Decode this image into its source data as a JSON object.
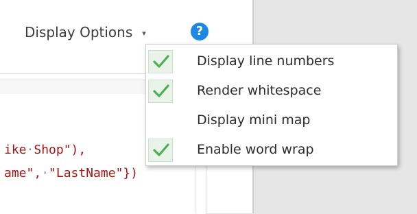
{
  "toolbar": {
    "display_options_label": "Display Options",
    "dropdown_arrow": "▾",
    "help_glyph": "?"
  },
  "editor": {
    "lines": [
      {
        "text_a": "ike",
        "dot": "·",
        "text_b": "Shop\"),",
        "kind": "string-line"
      },
      {
        "text_a": "ame\",",
        "dot": "·",
        "text_b": "\"LastName\"})",
        "kind": "string-line"
      }
    ]
  },
  "menu": {
    "items": [
      {
        "label": "Display line numbers",
        "checked": true
      },
      {
        "label": "Render whitespace",
        "checked": true
      },
      {
        "label": "Display mini map",
        "checked": false
      },
      {
        "label": "Enable word wrap",
        "checked": true
      }
    ]
  },
  "colors": {
    "check_green": "#4caf50",
    "help_blue": "#1e88e5",
    "string_red": "#a31515"
  },
  "icons": {
    "help": "help-circle-icon",
    "check": "check-icon",
    "dropdown": "chevron-down-icon"
  }
}
